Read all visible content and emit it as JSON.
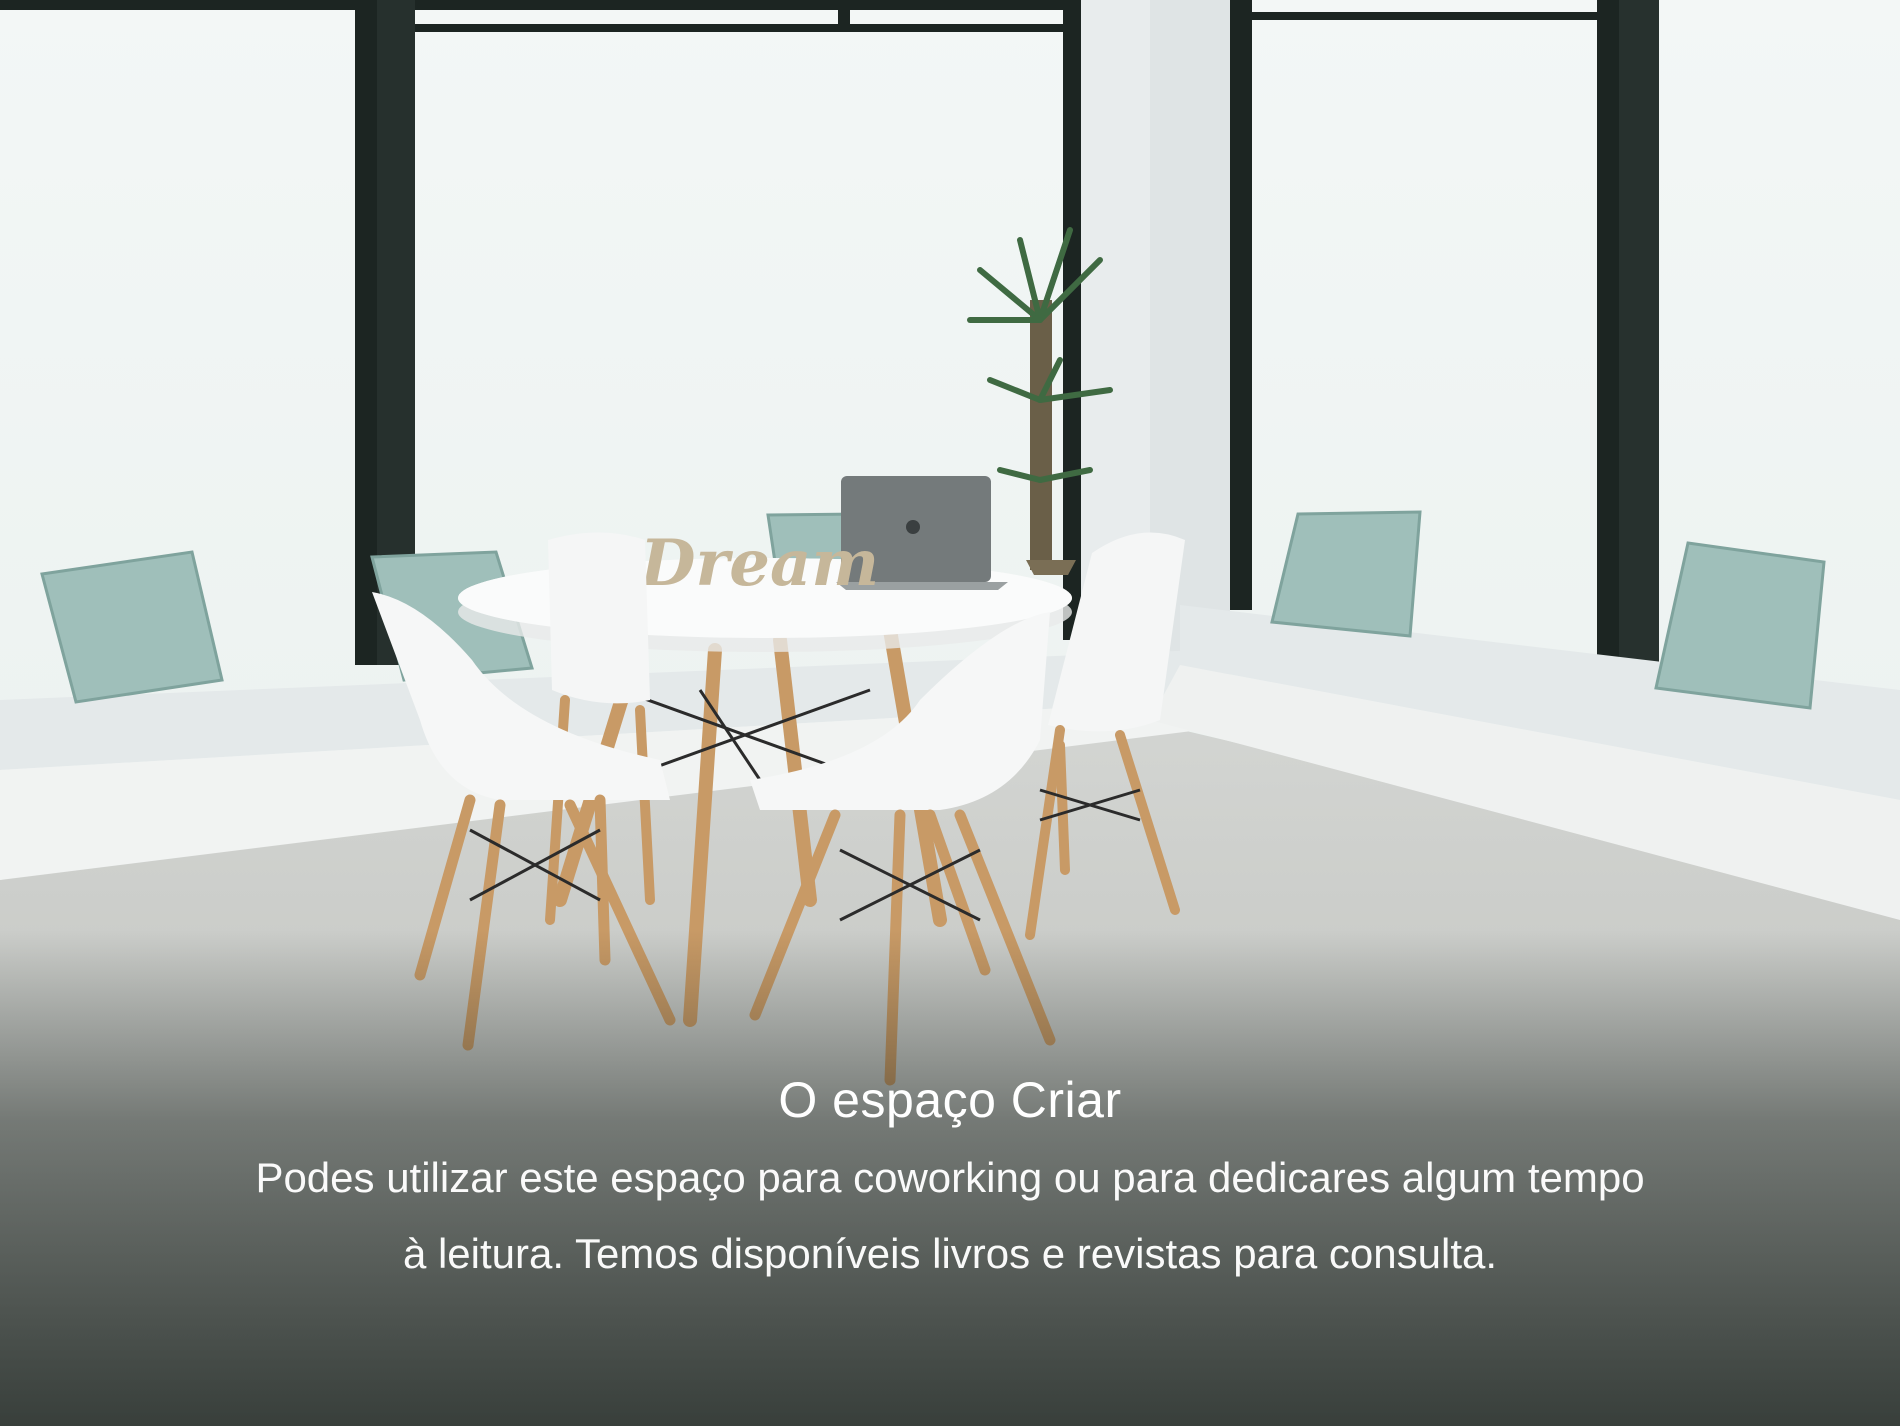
{
  "caption": {
    "title": "O espaço Criar",
    "description_line1": "Podes utilizar este espaço para coworking ou para dedicares algum tempo",
    "description_line2": "à leitura. Temos disponíveis livros e revistas para consulta."
  },
  "scene": {
    "sign_text": "Dream"
  },
  "colors": {
    "window_frame": "#1c2522",
    "window_glass": "#eef3f2",
    "wall": "#eceff0",
    "floor": "#c9cbc8",
    "cushion": "#9fbfba",
    "seat_pad": "#e4e9ea",
    "chair": "#f6f7f7",
    "wood": "#c89a66",
    "caption_text": "#ffffff"
  }
}
